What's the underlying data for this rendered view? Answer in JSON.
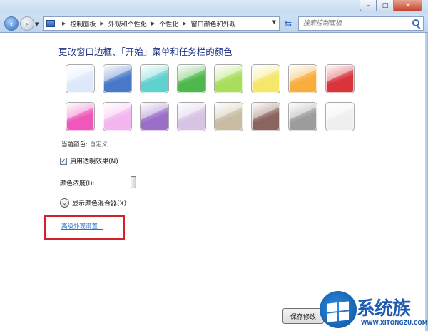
{
  "window": {
    "controls": {
      "minimize": "–",
      "maximize": "□",
      "close": "✕"
    }
  },
  "navigation": {
    "back_icon": "back-arrow-icon",
    "forward_icon": "forward-arrow-icon",
    "breadcrumb": [
      "控制面板",
      "外观和个性化",
      "个性化",
      "窗口颜色和外观"
    ],
    "search_placeholder": "搜索控制面板"
  },
  "main": {
    "heading": "更改窗口边框、「开始」菜单和任务栏的颜色",
    "swatches": [
      {
        "name": "sky",
        "color": "#dde9fb"
      },
      {
        "name": "twilight",
        "color": "#4a78c8"
      },
      {
        "name": "sea",
        "color": "#5fd1cf"
      },
      {
        "name": "leaf",
        "color": "#4fb84c"
      },
      {
        "name": "lime",
        "color": "#a9de5c"
      },
      {
        "name": "sun",
        "color": "#f4e76a"
      },
      {
        "name": "pumpkin",
        "color": "#f7ae3f"
      },
      {
        "name": "ruby",
        "color": "#d9333c"
      },
      {
        "name": "fuchsia",
        "color": "#ef57bb"
      },
      {
        "name": "blush",
        "color": "#f3b6ef"
      },
      {
        "name": "violet",
        "color": "#9b6fc8"
      },
      {
        "name": "lavender",
        "color": "#d7c3e3"
      },
      {
        "name": "taupe",
        "color": "#c8bda2"
      },
      {
        "name": "chocolate",
        "color": "#8a6560"
      },
      {
        "name": "slate",
        "color": "#9c9c9c"
      },
      {
        "name": "frost",
        "color": "#efefef"
      }
    ],
    "current_color_label": "当前颜色:",
    "current_color_value": "自定义",
    "transparency": {
      "label": "启用透明效果(N)",
      "checked": true,
      "check_mark": "✓"
    },
    "intensity_label": "颜色浓度(I):",
    "intensity_fraction": 0.15,
    "mixer": {
      "label": "显示颜色混合器(X)",
      "icon": "⌄"
    },
    "advanced_link": "高级外观设置...",
    "save_button": "保存修改"
  },
  "watermark": {
    "name": "系统族",
    "url": "WWW.XITONGZU.COM"
  },
  "colors": {
    "heading": "#1e3287",
    "link": "#2b6ec7",
    "highlight_box": "#d3232a"
  }
}
